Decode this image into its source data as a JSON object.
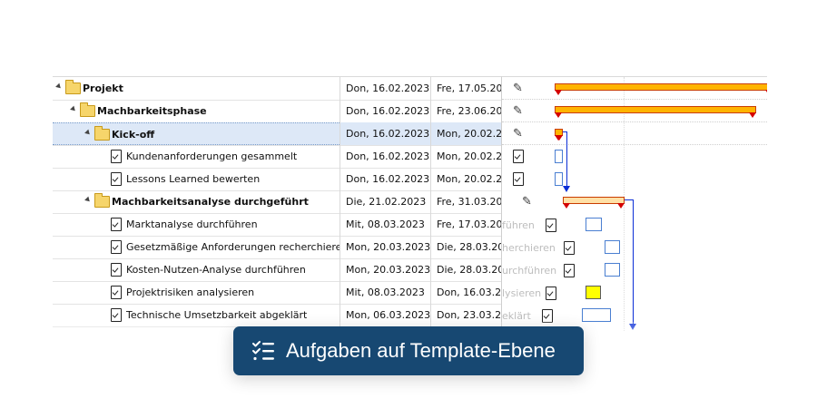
{
  "badge": {
    "text": "Aufgaben auf Template-Ebene",
    "icon": "checklist-icon",
    "color": "#174872"
  },
  "rows": [
    {
      "name": "Projekt",
      "start": "Don, 16.02.2023",
      "end": "Fre, 17.05.2023"
    },
    {
      "name": "Machbarkeitsphase",
      "start": "Don, 16.02.2023",
      "end": "Fre, 23.06.2023"
    },
    {
      "name": "Kick-off",
      "start": "Don, 16.02.2023",
      "end": "Mon, 20.02.2023"
    },
    {
      "name": "Kundenanforderungen gesammelt",
      "start": "Don, 16.02.2023",
      "end": "Mon, 20.02.2023"
    },
    {
      "name": "Lessons Learned bewerten",
      "start": "Don, 16.02.2023",
      "end": "Mon, 20.02.2023"
    },
    {
      "name": "Machbarkeitsanalyse durchgeführt",
      "start": "Die, 21.02.2023",
      "end": "Fre, 31.03.2023"
    },
    {
      "name": "Marktanalyse durchführen",
      "start": "Mit, 08.03.2023",
      "end": "Fre, 17.03.2023"
    },
    {
      "name": "Gesetzmäßige Anforderungen recherchieren",
      "start": "Mon, 20.03.2023",
      "end": "Die, 28.03.2023"
    },
    {
      "name": "Kosten-Nutzen-Analyse durchführen",
      "start": "Mon, 20.03.2023",
      "end": "Die, 28.03.2023"
    },
    {
      "name": "Projektrisiken analysieren",
      "start": "Mit, 08.03.2023",
      "end": "Don, 16.03.2023"
    },
    {
      "name": "Technische Umsetzbarkeit abgeklärt",
      "start": "Mon, 06.03.2023",
      "end": "Don, 23.03.2023"
    }
  ],
  "gantt_labels": [
    "führen",
    "herchieren",
    "urchführen",
    "lysieren",
    "eklärt"
  ],
  "colors": {
    "summary_bar": "#ffb400",
    "milestone_red": "#d40000",
    "link_blue": "#0b2ed6",
    "task_border": "#4a7fd1",
    "highlight_task": "#ffff00",
    "selected_row": "#dde8f7"
  }
}
